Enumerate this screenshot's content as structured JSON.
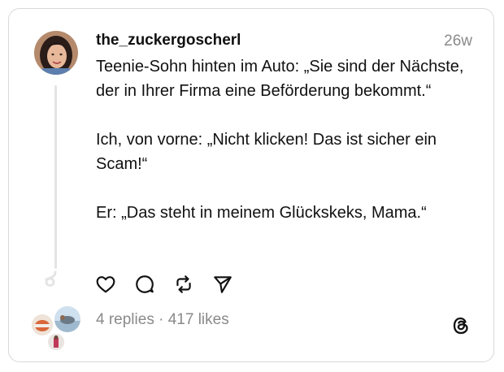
{
  "post": {
    "username": "the_zuckergoscherl",
    "time": "26w",
    "paragraphs": [
      "Teenie-Sohn hinten im Auto: „Sie sind der Nächste, der in Ihrer Firma eine Beförderung bekommt.“",
      "Ich, von vorne: „Nicht klicken! Das ist sicher ein Scam!“",
      "Er: „Das steht in meinem Glückskeks, Mama.“"
    ]
  },
  "actions": {
    "like_icon": "heart-icon",
    "reply_icon": "comment-icon",
    "repost_icon": "repost-icon",
    "share_icon": "send-icon"
  },
  "stats": {
    "replies": "4 replies",
    "separator": " · ",
    "likes": "417 likes"
  },
  "brand": {
    "logo_icon": "threads-logo-icon"
  }
}
